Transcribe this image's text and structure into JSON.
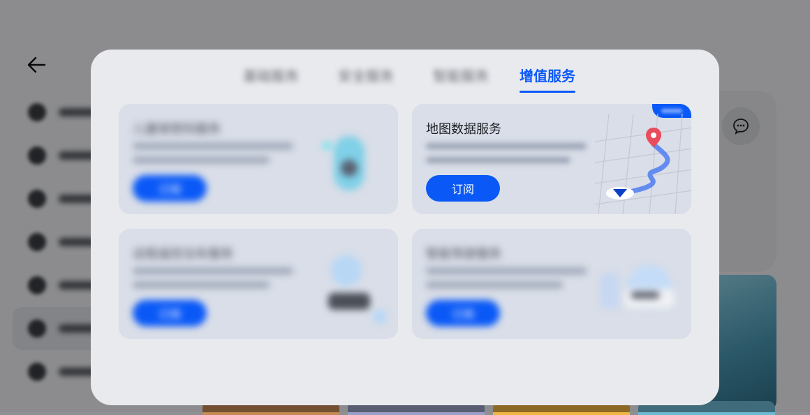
{
  "modal": {
    "tabs": [
      {
        "label": "基础服务",
        "active": false
      },
      {
        "label": "安全服务",
        "active": false
      },
      {
        "label": "智能服务",
        "active": false
      },
      {
        "label": "增值服务",
        "active": true
      }
    ],
    "cards": [
      {
        "title": "儿童锁密码服务",
        "button": "订阅",
        "blurred": true
      },
      {
        "title": "地图数据服务",
        "button": "订阅",
        "blurred": false
      },
      {
        "title": "远程遥控泊车服务",
        "button": "订阅",
        "blurred": true
      },
      {
        "title": "智能驾驶服务",
        "button": "订阅",
        "blurred": true
      }
    ]
  },
  "colors": {
    "accent": "#0a59f7",
    "card_bg": "#d9dee8",
    "modal_bg": "#e9eaee",
    "pin": "#e84d5b"
  },
  "icons": {
    "back": "arrow-left-icon",
    "chat": "chat-bubble-icon",
    "pin": "location-pin-icon",
    "nav": "navigation-arrow-icon"
  }
}
